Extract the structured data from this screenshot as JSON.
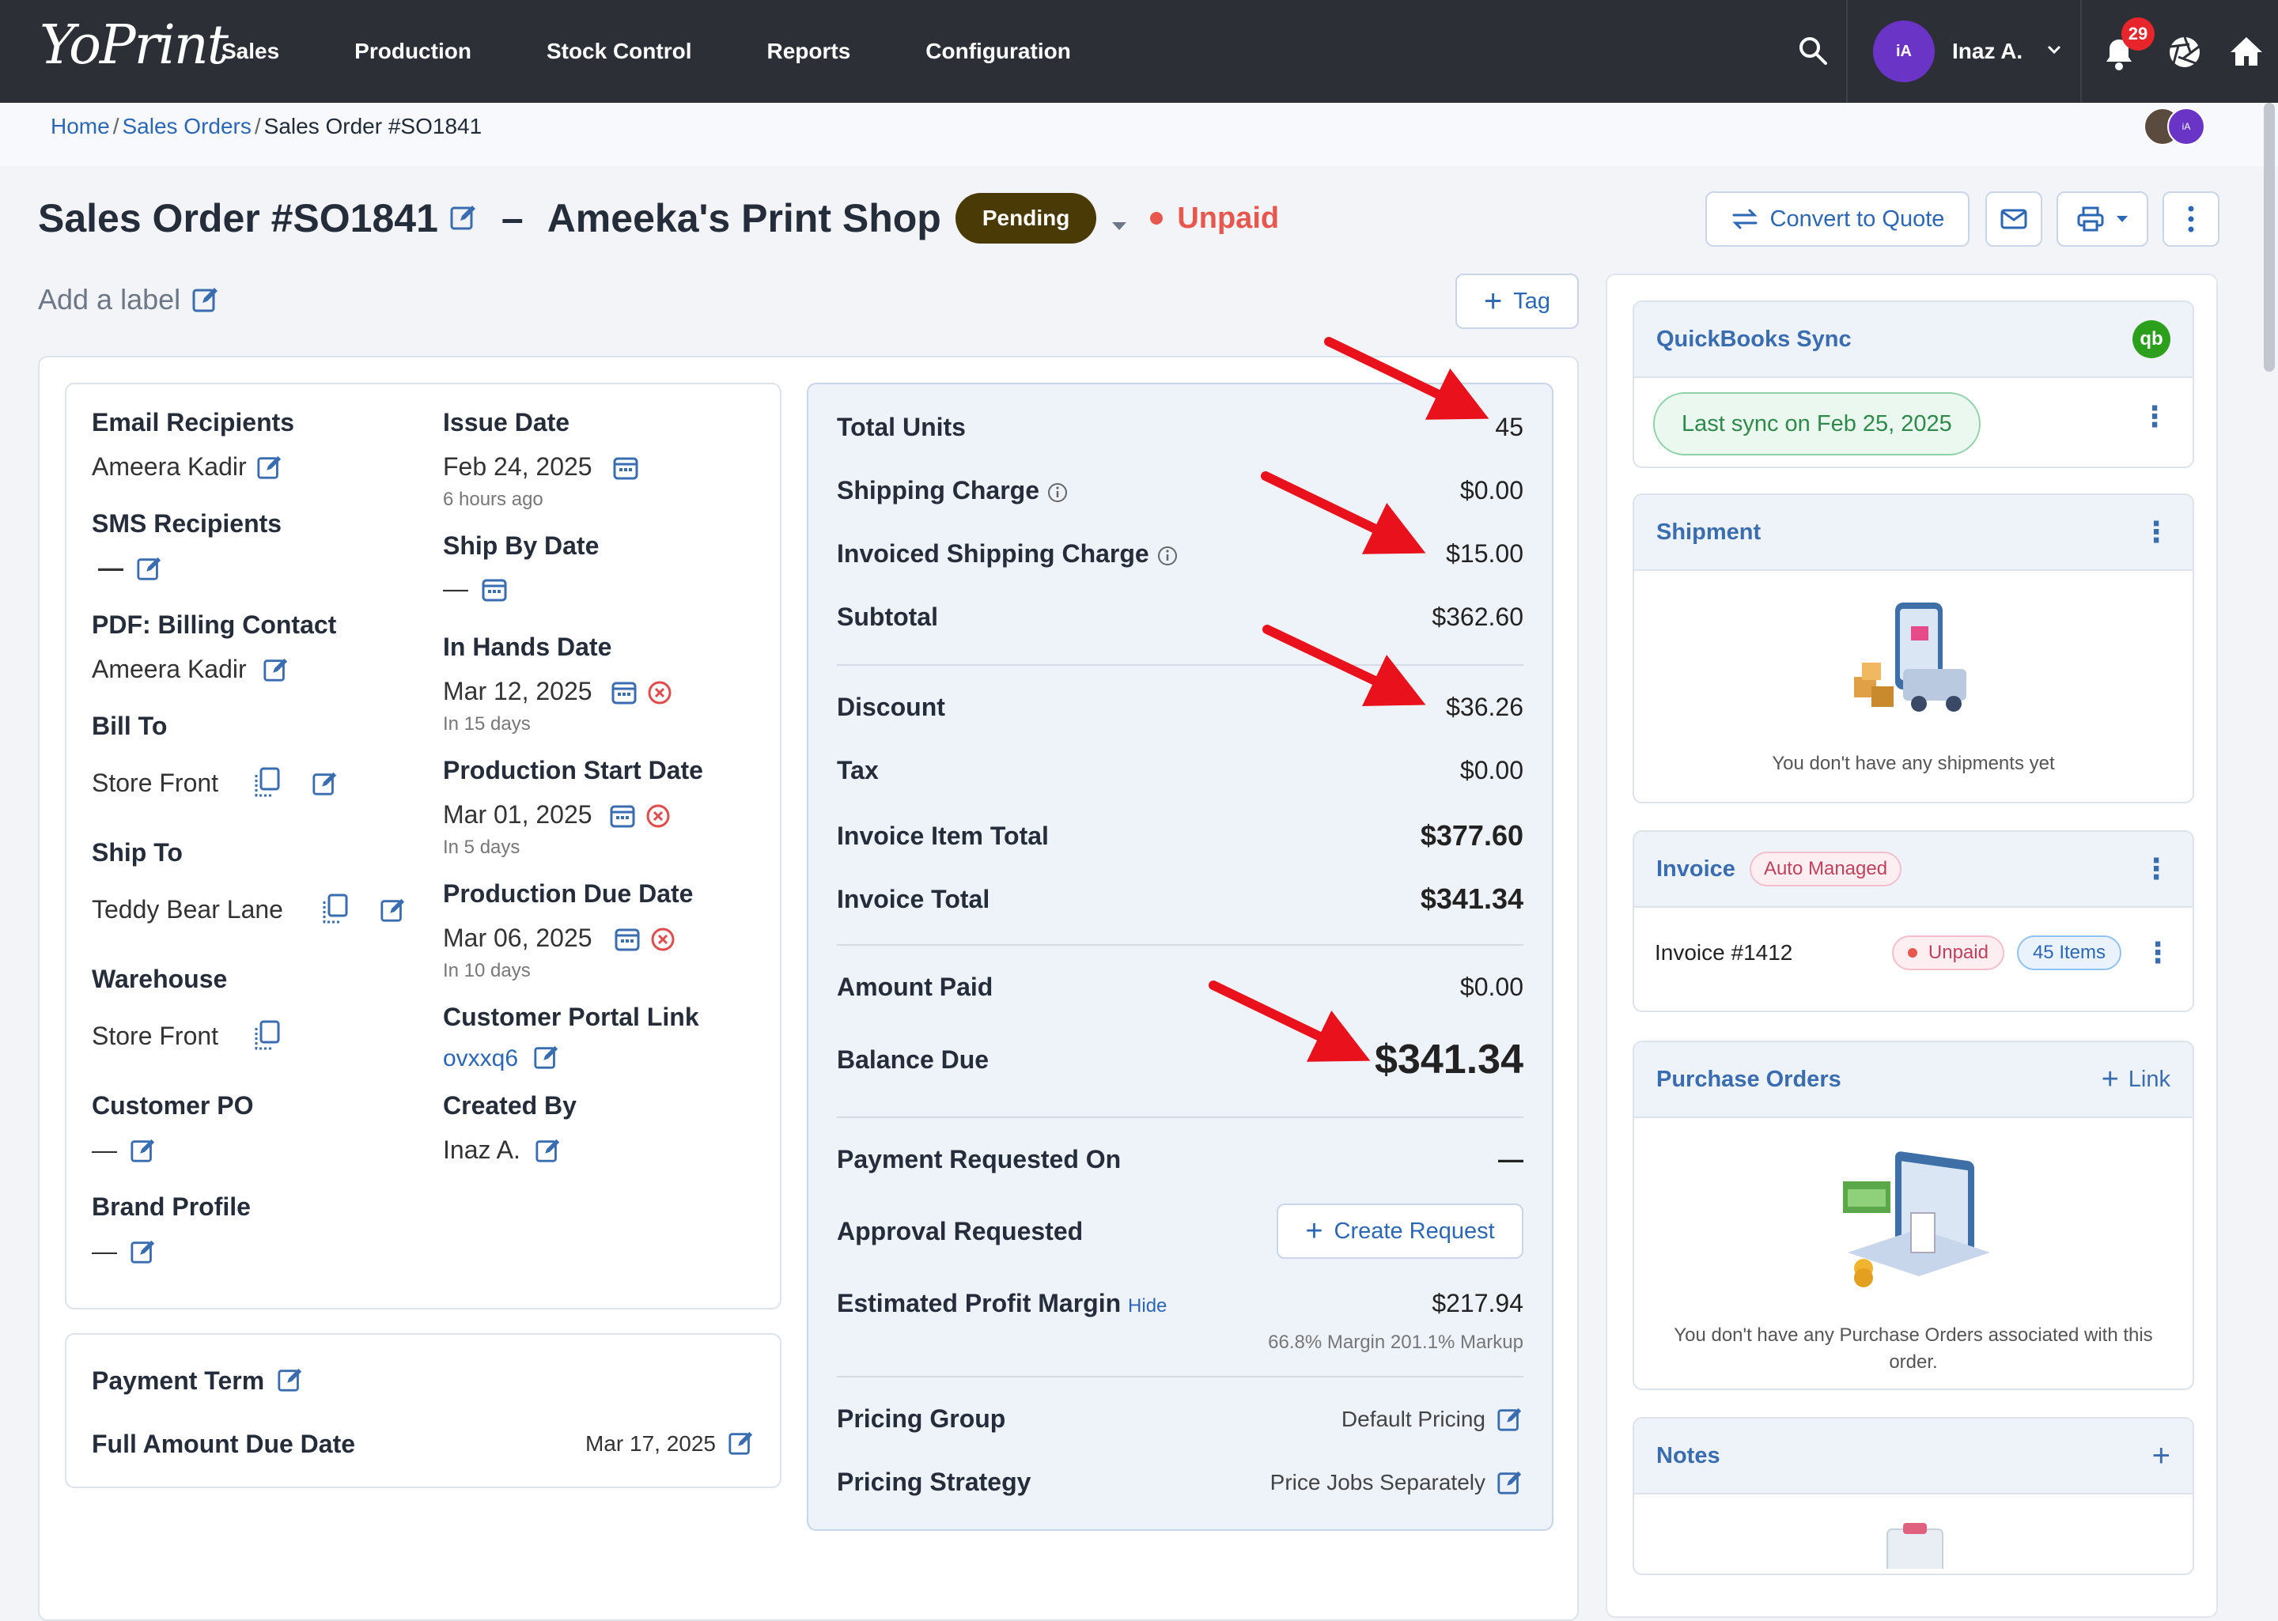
{
  "nav": {
    "logo": "YoPrint",
    "menu": [
      "Sales",
      "Production",
      "Stock Control",
      "Reports",
      "Configuration"
    ],
    "user_initials": "iA",
    "user_name": "Inaz A.",
    "notification_count": "29"
  },
  "breadcrumb": {
    "home": "Home",
    "sales_orders": "Sales Orders",
    "current": "Sales Order #SO1841"
  },
  "presence_avatar_initials": "iA",
  "header": {
    "title": "Sales Order #SO1841",
    "dash": "–",
    "customer": "Ameeka's Print Shop",
    "status": "Pending",
    "payment_status": "Unpaid",
    "convert_button": "Convert to Quote",
    "add_label": "Add a label",
    "tag_button": "Tag"
  },
  "details": {
    "email_recipients_label": "Email Recipients",
    "email_recipients_value": "Ameera Kadir",
    "sms_recipients_label": "SMS Recipients",
    "sms_recipients_value": "—",
    "pdf_billing_label": "PDF: Billing Contact",
    "pdf_billing_value": "Ameera Kadir",
    "bill_to_label": "Bill To",
    "bill_to_value": "Store Front",
    "ship_to_label": "Ship To",
    "ship_to_value": "Teddy Bear Lane",
    "warehouse_label": "Warehouse",
    "warehouse_value": "Store Front",
    "customer_po_label": "Customer PO",
    "customer_po_value": "—",
    "brand_profile_label": "Brand Profile",
    "brand_profile_value": "—",
    "issue_date_label": "Issue Date",
    "issue_date_value": "Feb 24, 2025",
    "issue_date_rel": "6 hours ago",
    "ship_by_label": "Ship By Date",
    "ship_by_value": "—",
    "in_hands_label": "In Hands Date",
    "in_hands_value": "Mar 12, 2025",
    "in_hands_rel": "In 15 days",
    "prod_start_label": "Production Start Date",
    "prod_start_value": "Mar 01, 2025",
    "prod_start_rel": "In 5 days",
    "prod_due_label": "Production Due Date",
    "prod_due_value": "Mar 06, 2025",
    "prod_due_rel": "In 10 days",
    "portal_label": "Customer Portal Link",
    "portal_value": "ovxxq6",
    "created_by_label": "Created By",
    "created_by_value": "Inaz A."
  },
  "payment": {
    "term_label": "Payment Term",
    "due_date_label": "Full Amount Due Date",
    "due_date_value": "Mar 17, 2025"
  },
  "summary": {
    "total_units_label": "Total Units",
    "total_units": "45",
    "shipping_label": "Shipping Charge",
    "shipping": "$0.00",
    "inv_shipping_label": "Invoiced Shipping Charge",
    "inv_shipping": "$15.00",
    "subtotal_label": "Subtotal",
    "subtotal": "$362.60",
    "discount_label": "Discount",
    "discount": "$36.26",
    "tax_label": "Tax",
    "tax": "$0.00",
    "item_total_label": "Invoice Item Total",
    "item_total": "$377.60",
    "invoice_total_label": "Invoice Total",
    "invoice_total": "$341.34",
    "amount_paid_label": "Amount Paid",
    "amount_paid": "$0.00",
    "balance_label": "Balance Due",
    "balance": "$341.34",
    "payment_requested_label": "Payment Requested On",
    "payment_requested": "—",
    "approval_label": "Approval Requested",
    "create_request": "Create Request",
    "profit_label": "Estimated Profit Margin",
    "profit_hide": "Hide",
    "profit": "$217.94",
    "profit_detail": "66.8% Margin 201.1% Markup",
    "pricing_group_label": "Pricing Group",
    "pricing_group": "Default Pricing",
    "pricing_strategy_label": "Pricing Strategy",
    "pricing_strategy": "Price Jobs Separately"
  },
  "sidebar": {
    "qb_title": "QuickBooks Sync",
    "qb_sync": "Last sync on Feb 25, 2025",
    "shipment_title": "Shipment",
    "shipment_empty": "You don't have any shipments yet",
    "invoice_title": "Invoice",
    "invoice_badge": "Auto Managed",
    "invoice_number": "Invoice #1412",
    "invoice_status": "Unpaid",
    "invoice_items": "45 Items",
    "po_title": "Purchase Orders",
    "po_link": "Link",
    "po_empty": "You don't have any Purchase Orders associated with this order.",
    "notes_title": "Notes"
  },
  "colors": {
    "accent": "#2b67b5",
    "pending": "#4a3a06",
    "unpaid": "#e8574d",
    "arrow": "#e8111c",
    "nav": "#2c2f36"
  }
}
